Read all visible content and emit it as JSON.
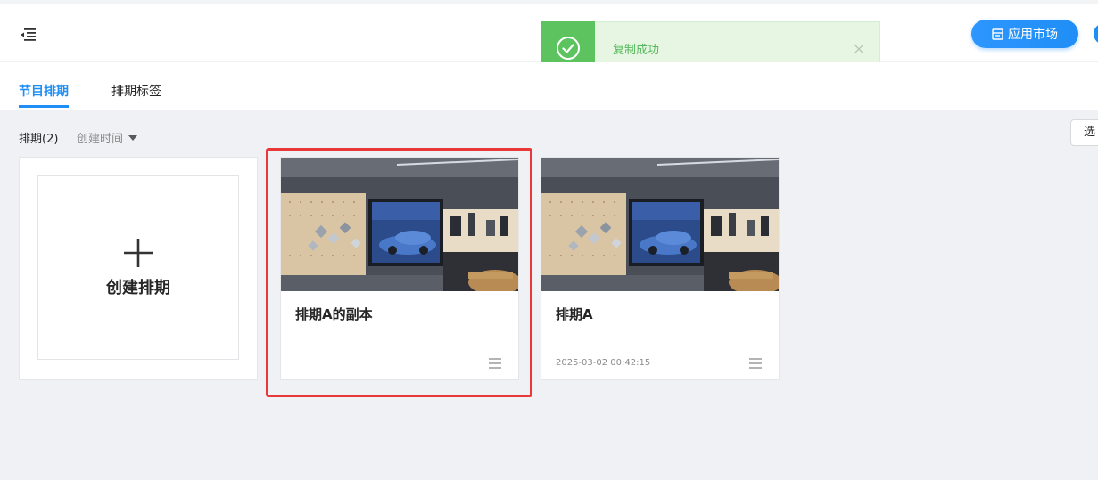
{
  "header": {
    "app_market_label": "应用市场"
  },
  "toast": {
    "message": "复制成功",
    "type": "success"
  },
  "tabs": [
    {
      "label": "节目排期",
      "active": true
    },
    {
      "label": "排期标签",
      "active": false
    }
  ],
  "toolbar": {
    "count_label": "排期(2)",
    "sort_label": "创建时间",
    "select_label": "选"
  },
  "create_card": {
    "label": "创建排期"
  },
  "schedules": [
    {
      "title": "排期A的副本",
      "created": "",
      "highlighted": true
    },
    {
      "title": "排期A",
      "created": "2025-03-02 00:42:15",
      "highlighted": false
    }
  ],
  "colors": {
    "accent": "#1f8ef5",
    "success": "#5cc35f",
    "highlight": "#e8383a"
  }
}
